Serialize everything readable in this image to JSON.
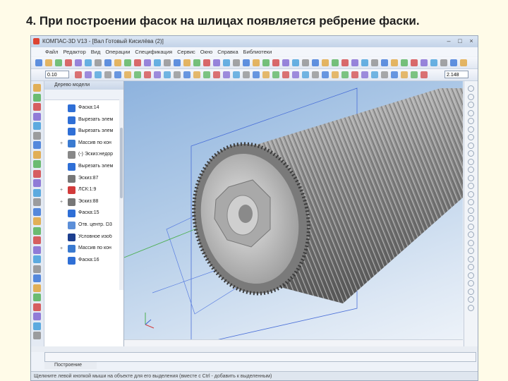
{
  "slide": {
    "title": "4. При построении фасок на шлицах появляется ребрение фаски."
  },
  "window": {
    "title": "КОМПАС-3D V13 - [Вал Готовый Кисилёва (2)]"
  },
  "menu": [
    "Файл",
    "Редактор",
    "Вид",
    "Операции",
    "Спецификация",
    "Сервис",
    "Окно",
    "Справка",
    "Библиотеки"
  ],
  "toolbar": {
    "scale_value": "0.10",
    "zoom_value": "2.148"
  },
  "tree": {
    "header": "Дерево модели",
    "items": [
      {
        "label": "Фаска:14",
        "expand": "",
        "color": "#2f6fd6"
      },
      {
        "label": "Вырезать элем",
        "expand": "",
        "color": "#2f6fd6"
      },
      {
        "label": "Вырезать элем",
        "expand": "",
        "color": "#2f6fd6"
      },
      {
        "label": "Массив по кон",
        "expand": "+",
        "color": "#3a7ad0"
      },
      {
        "label": "(-) Эскиз:недор",
        "expand": "",
        "color": "#888888"
      },
      {
        "label": "Вырезать элем",
        "expand": "",
        "color": "#2f6fd6"
      },
      {
        "label": "Эскиз:87",
        "expand": "",
        "color": "#777777"
      },
      {
        "label": "ЛСК:1:9",
        "expand": "+",
        "color": "#d23b3b"
      },
      {
        "label": "Эскиз:88",
        "expand": "+",
        "color": "#777777"
      },
      {
        "label": "Фаска:15",
        "expand": "",
        "color": "#2f6fd6"
      },
      {
        "label": "Отв. центр. D3",
        "expand": "",
        "color": "#5c8fd8"
      },
      {
        "label": "Условное изоб",
        "expand": "",
        "color": "#1d3f8f"
      },
      {
        "label": "Массив по кон",
        "expand": "+",
        "color": "#3a7ad0"
      },
      {
        "label": "Фаска:16",
        "expand": "",
        "color": "#2f6fd6"
      }
    ]
  },
  "panel": {
    "tab_label": "Построение"
  },
  "status": {
    "text": "Щелкните левой кнопкой мыши на объекте для его выделения (вместе с Ctrl - добавить к выделенным)"
  },
  "colors": {
    "window_bg": "#eef2f8",
    "viewport_top": "#8eb3de",
    "viewport_bottom": "#eef3f9",
    "part_face": "#9a9a9a",
    "plane_blue": "#4a6fd8",
    "plane_green": "#4caf50"
  }
}
